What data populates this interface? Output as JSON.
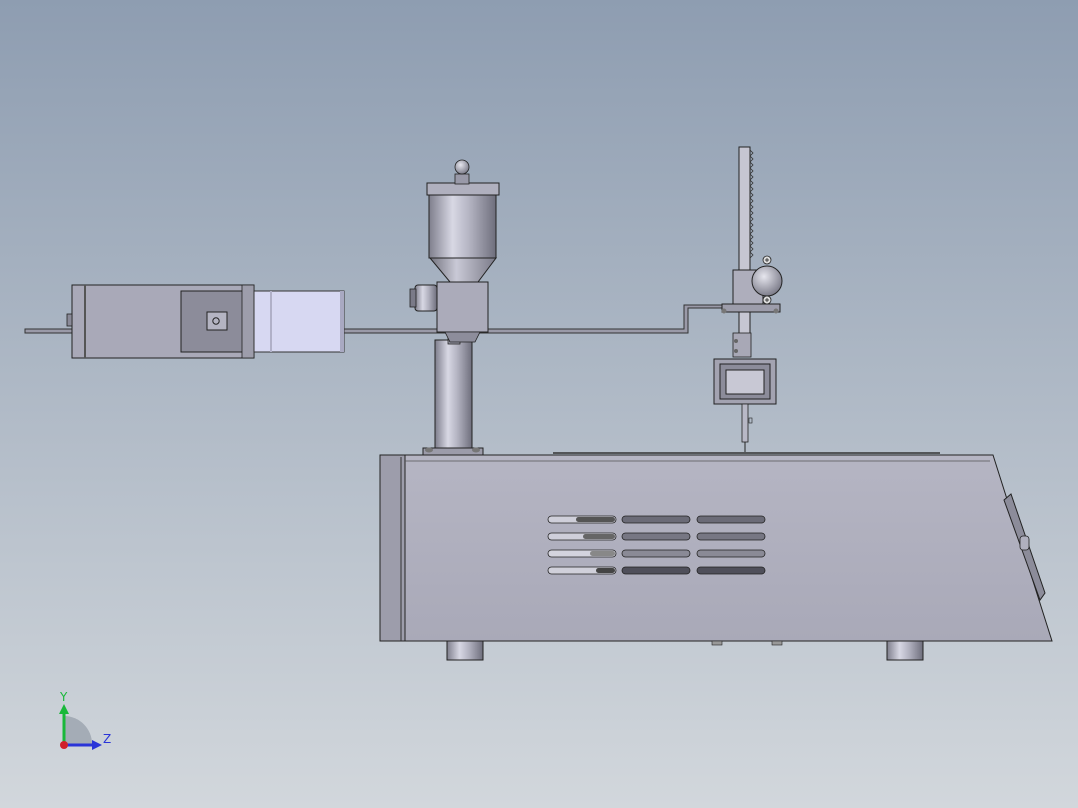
{
  "view": {
    "background_top": "#8e9db1",
    "background_bottom": "#d2d7dc"
  },
  "triad": {
    "y_label": "Y",
    "z_label": "Z",
    "y_color": "#19b83a",
    "z_color": "#2a34d8",
    "x_color": "#d0202a"
  },
  "model": {
    "parts": [
      "motor-housing",
      "extrusion-barrel",
      "hopper",
      "feed-block",
      "support-column",
      "rail-bracket",
      "vertical-rack",
      "adjustment-knob",
      "nozzle-block",
      "machine-base",
      "vent-slots",
      "control-panel",
      "base-feet"
    ]
  }
}
